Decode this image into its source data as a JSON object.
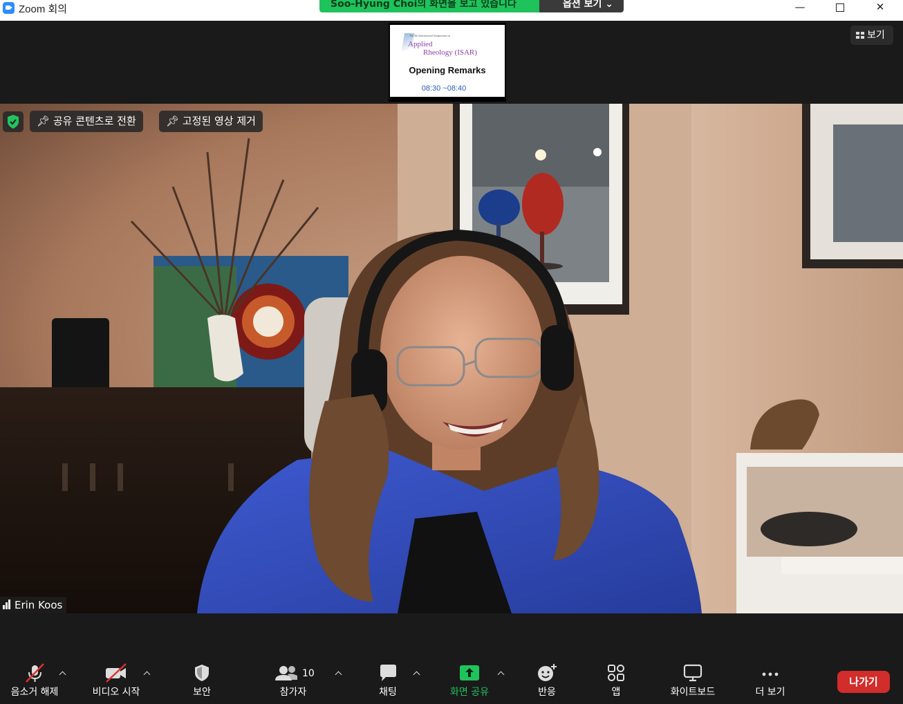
{
  "window": {
    "title": "Zoom 회의",
    "minimize": "—",
    "close": "✕"
  },
  "share_banner": {
    "text": "Soo-Hyung Choi의 화면을 보고 있습니다",
    "options_label": "옵션 보기 ⌄"
  },
  "shared_slide": {
    "tiny_text": "The 9th International Symposium on",
    "logo_line1": "Applied",
    "logo_line2": "Rheology (ISAR)",
    "title": "Opening Remarks",
    "time": "08:30 ~08:40"
  },
  "view_button": {
    "label": "보기"
  },
  "video_overlay": {
    "switch_label": "공유 콘텐츠로 전환",
    "unpin_label": "고정된 영상 제거",
    "participant_name": "Erin Koos"
  },
  "toolbar": {
    "mute_label": "음소거 해제",
    "video_label": "비디오 시작",
    "security_label": "보안",
    "participants_label": "참가자",
    "participants_count": "10",
    "chat_label": "채팅",
    "share_label": "화면 공유",
    "reactions_label": "반응",
    "apps_label": "앱",
    "whiteboard_label": "화이트보드",
    "more_label": "더 보기",
    "leave_label": "나가기"
  },
  "colors": {
    "share_green": "#1fc35b",
    "leave_red": "#d12d2a",
    "muted_red": "#e0312b",
    "toolbar_bg": "#1a1a1a"
  }
}
